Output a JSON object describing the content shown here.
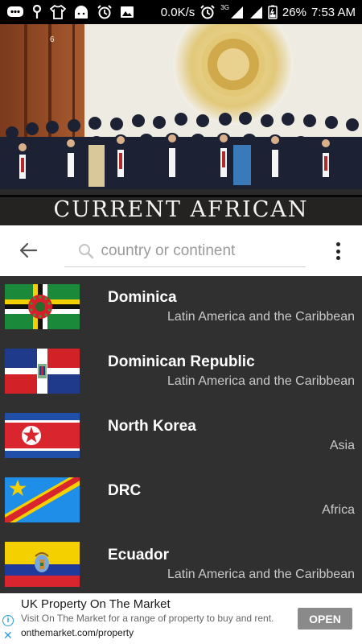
{
  "status_bar": {
    "network_speed": "0.0K/s",
    "network_type": "3G",
    "battery": "26%",
    "time": "7:53 AM",
    "icons": [
      "chat-icon",
      "hook-icon",
      "shirt-icon",
      "android-icon",
      "alarm-icon",
      "image-icon",
      "alarm-icon",
      "signal-icon",
      "signal-icon",
      "battery-icon"
    ]
  },
  "banner": {
    "title": "CURRENT AFRICAN LEADERS",
    "background_text": "6"
  },
  "search": {
    "placeholder": "country or continent",
    "value": ""
  },
  "countries": [
    {
      "name": "Dominica",
      "region": "Latin America and the Caribbean",
      "flag": "dominica-flag"
    },
    {
      "name": "Dominican Republic",
      "region": "Latin America and the Caribbean",
      "flag": "dominican-republic-flag"
    },
    {
      "name": "North Korea",
      "region": "Asia",
      "flag": "north-korea-flag"
    },
    {
      "name": "DRC",
      "region": "Africa",
      "flag": "drc-flag"
    },
    {
      "name": "Ecuador",
      "region": "Latin America and the Caribbean",
      "flag": "ecuador-flag"
    }
  ],
  "ad": {
    "title": "UK Property On The Market",
    "description": "Visit On The Market for a range of property to buy and rent.",
    "url": "onthemarket.com/property",
    "button": "OPEN",
    "info_glyph": "i",
    "close_glyph": "✕"
  },
  "colors": {
    "list_background": "#303030",
    "status_bar": "#000000",
    "ad_button": "#8a8a8a"
  }
}
